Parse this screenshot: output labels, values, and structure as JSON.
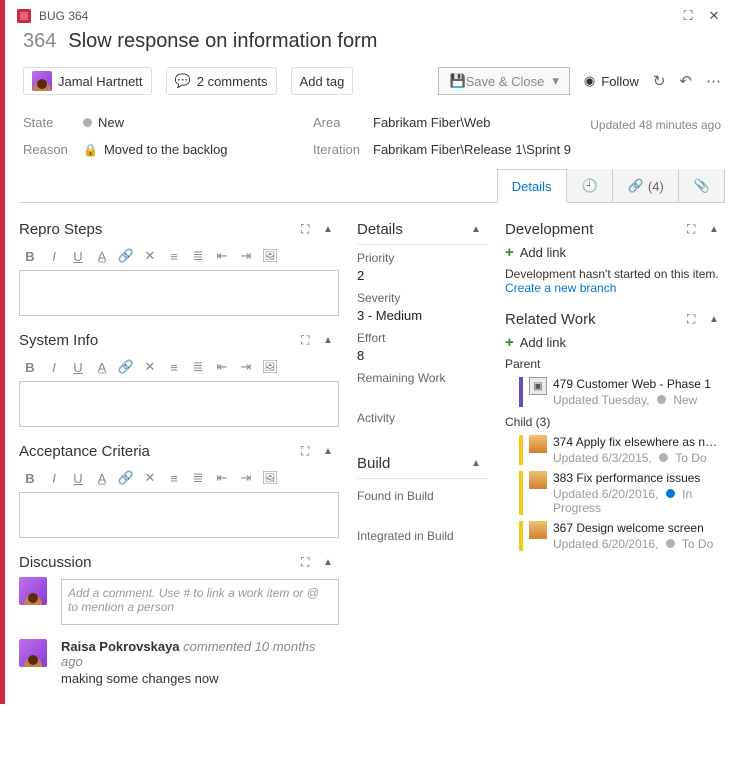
{
  "header": {
    "badge": "BUG 364",
    "id": "364",
    "title": "Slow response on information form"
  },
  "cmd": {
    "assignee": "Jamal Hartnett",
    "comments": "2 comments",
    "add_tag": "Add tag",
    "save": "Save & Close",
    "follow": "Follow"
  },
  "updated": "Updated 48 minutes ago",
  "info": {
    "state_lbl": "State",
    "state_val": "New",
    "reason_lbl": "Reason",
    "reason_val": "Moved to the backlog",
    "area_lbl": "Area",
    "area_val": "Fabrikam Fiber\\Web",
    "iter_lbl": "Iteration",
    "iter_val": "Fabrikam Fiber\\Release 1\\Sprint 9"
  },
  "tabs": {
    "details": "Details",
    "links_count": "(4)"
  },
  "left": {
    "repro": "Repro Steps",
    "sysinfo": "System Info",
    "accept": "Acceptance Criteria",
    "discussion": "Discussion",
    "comment_placeholder": "Add a comment. Use # to link a work item or @ to mention a person",
    "comment": {
      "author": "Raisa Pokrovskaya",
      "meta_prefix": "commented",
      "meta_time": "10 months ago",
      "text": "making some changes now"
    }
  },
  "mid": {
    "details": "Details",
    "priority_lbl": "Priority",
    "priority_val": "2",
    "severity_lbl": "Severity",
    "severity_val": "3 - Medium",
    "effort_lbl": "Effort",
    "effort_val": "8",
    "remaining_lbl": "Remaining Work",
    "activity_lbl": "Activity",
    "build": "Build",
    "found_lbl": "Found in Build",
    "integ_lbl": "Integrated in Build"
  },
  "right": {
    "dev": "Development",
    "addlink": "Add link",
    "dev_msg": "Development hasn't started on this item.",
    "create_branch": "Create a new branch",
    "related": "Related Work",
    "parent_lbl": "Parent",
    "parent": {
      "id": "479",
      "title": "Customer Web - Phase 1",
      "sub": "Updated Tuesday,",
      "state": "New"
    },
    "child_lbl": "Child (3)",
    "children": [
      {
        "id": "374",
        "title": "Apply fix elsewhere as n…",
        "sub": "Updated 6/3/2015,",
        "state": "To Do"
      },
      {
        "id": "383",
        "title": "Fix performance issues",
        "sub": "Updated 6/20/2016,",
        "state": "In Progress"
      },
      {
        "id": "367",
        "title": "Design welcome screen",
        "sub": "Updated 6/20/2016,",
        "state": "To Do"
      }
    ]
  }
}
